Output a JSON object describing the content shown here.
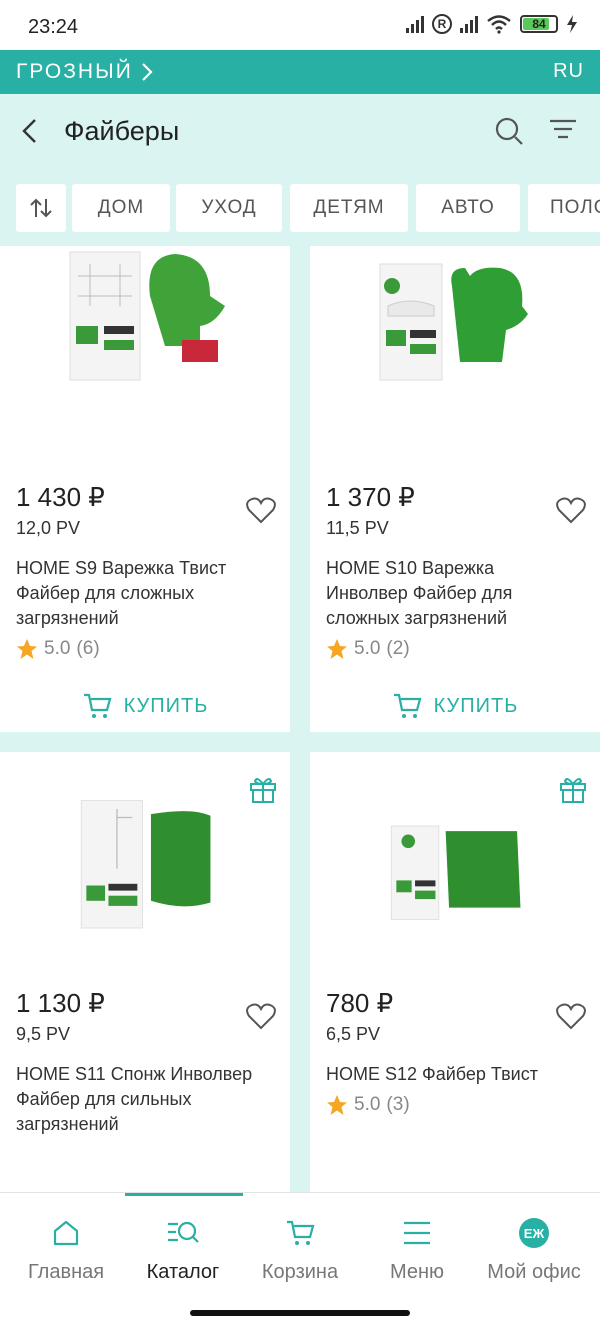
{
  "status_bar": {
    "time": "23:24",
    "battery": "84",
    "r_badge": "R"
  },
  "region_bar": {
    "city": "ГРОЗНЫЙ",
    "language": "RU"
  },
  "header": {
    "title": "Файберы"
  },
  "filter_chips": [
    "ДОМ",
    "УХОД",
    "ДЕТЯМ",
    "АВТО",
    "ПОЛО"
  ],
  "products": [
    {
      "price": "1 430 ₽",
      "pv": "12,0 PV",
      "name": "HOME S9 Варежка Твист Файбер для сложных загрязнений",
      "rating": "5.0",
      "reviews": "(6)",
      "buy_label": "КУПИТЬ",
      "image": "mitt-twist",
      "gift": false
    },
    {
      "price": "1 370 ₽",
      "pv": "11,5 PV",
      "name": "HOME S10 Варежка Инволвер Файбер для сложных загрязнений",
      "rating": "5.0",
      "reviews": "(2)",
      "buy_label": "КУПИТЬ",
      "image": "mitt-involver",
      "gift": false
    },
    {
      "price": "1 130 ₽",
      "pv": "9,5 PV",
      "name": "HOME S11 Спонж Инволвер Файбер для сильных загрязнений",
      "rating": "",
      "reviews": "",
      "buy_label": "",
      "image": "sponge",
      "gift": true
    },
    {
      "price": "780 ₽",
      "pv": "6,5 PV",
      "name": "HOME S12 Файбер Твист",
      "rating": "5.0",
      "reviews": "(3)",
      "buy_label": "",
      "image": "cloth",
      "gift": true
    }
  ],
  "bottom_nav": [
    {
      "label": "Главная",
      "icon": "home-icon",
      "active": false
    },
    {
      "label": "Каталог",
      "icon": "catalog-search-icon",
      "active": true
    },
    {
      "label": "Корзина",
      "icon": "cart-icon",
      "active": false
    },
    {
      "label": "Меню",
      "icon": "menu-icon",
      "active": false
    },
    {
      "label": "Мой офис",
      "icon": "avatar",
      "active": false,
      "avatar_initials": "ЕЖ"
    }
  ],
  "colors": {
    "accent": "#27b0a3",
    "background": "#d9f4f1",
    "star": "#f5a623",
    "product_green": "#2e9a2a"
  }
}
